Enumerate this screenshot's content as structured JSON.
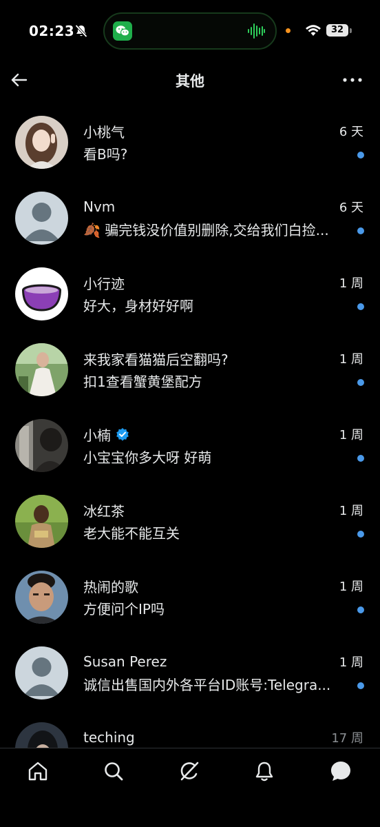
{
  "status_bar": {
    "time": "02:23",
    "battery": "32"
  },
  "header": {
    "title": "其他",
    "back_icon": "arrow-left-icon",
    "more_icon": "ellipsis-icon"
  },
  "conversations": [
    {
      "name": "小桃气",
      "time": "6 天",
      "preview": "看B吗?",
      "unread": true,
      "verified": false,
      "avatar": "photo"
    },
    {
      "name": "Nvm",
      "time": "6 天",
      "preview": "🍂 骗完钱没价值别删除,交给我们白捡...",
      "unread": true,
      "verified": false,
      "avatar": "default"
    },
    {
      "name": "小行迹",
      "time": "1 周",
      "preview": "好大，身材好好啊",
      "unread": true,
      "verified": false,
      "avatar": "bowl"
    },
    {
      "name": "来我家看猫猫后空翻吗?",
      "time": "1 周",
      "preview": "扣1查看蟹黄堡配方",
      "unread": true,
      "verified": false,
      "avatar": "photo"
    },
    {
      "name": "小楠",
      "time": "1 周",
      "preview": "小宝宝你多大呀 好萌",
      "unread": true,
      "verified": true,
      "avatar": "photo"
    },
    {
      "name": "冰红茶",
      "time": "1 周",
      "preview": "老大能不能互关",
      "unread": true,
      "verified": false,
      "avatar": "photo"
    },
    {
      "name": "热闹的歌",
      "time": "1 周",
      "preview": "方便问个IP吗",
      "unread": true,
      "verified": false,
      "avatar": "photo"
    },
    {
      "name": "Susan Perez",
      "time": "1 周",
      "preview": "诚信出售国内外各平台ID账号:Telegra...",
      "unread": true,
      "verified": false,
      "avatar": "default"
    },
    {
      "name": "teching",
      "time": "17 周",
      "preview": "",
      "unread": false,
      "verified": false,
      "avatar": "photo"
    }
  ],
  "bottom_nav": [
    {
      "name": "home",
      "icon": "home-icon"
    },
    {
      "name": "search",
      "icon": "search-icon"
    },
    {
      "name": "grok",
      "icon": "grok-icon"
    },
    {
      "name": "notifications",
      "icon": "bell-icon"
    },
    {
      "name": "messages",
      "icon": "messages-icon"
    }
  ],
  "colors": {
    "background": "#000000",
    "text": "#e7e9ea",
    "unread_dot": "#4a99e9",
    "verified": "#1d9bf0",
    "divider": "#2f3336"
  }
}
